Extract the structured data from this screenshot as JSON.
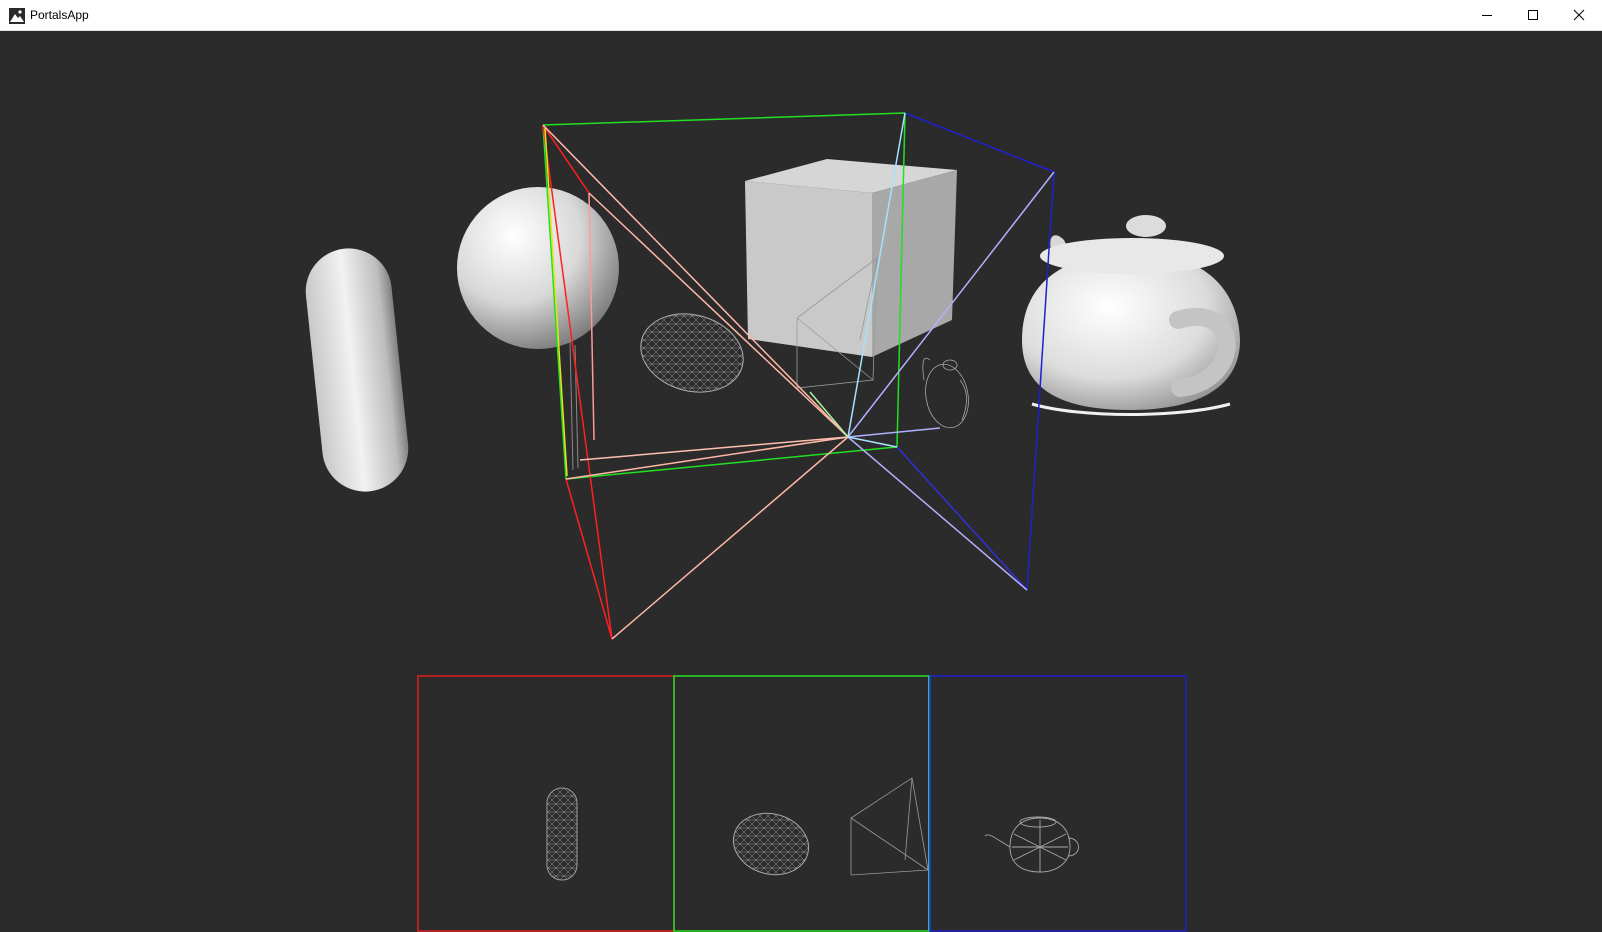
{
  "window": {
    "title": "PortalsApp",
    "app_icon": "portals-app-icon",
    "controls": {
      "minimize_icon": "minimize-icon",
      "maximize_icon": "maximize-icon",
      "close_icon": "close-icon"
    }
  },
  "scene": {
    "background_color": "#2b2b2b",
    "objects": [
      "capsule",
      "sphere",
      "cube",
      "teapot",
      "ellipsoid-wireframe",
      "pyramid-wireframe",
      "teapot-wireframe"
    ],
    "frustum_colors": {
      "red": "#ff2020",
      "green": "#20e020",
      "blue": "#2020ff",
      "pink": "#ffb0a0",
      "lavender": "#b0b0ff",
      "cyan": "#a0e0ff"
    }
  },
  "portals": [
    {
      "name": "red-portal",
      "border_color": "#e02020",
      "contents": "capsule-wireframe"
    },
    {
      "name": "green-portal",
      "border_color": "#20e020",
      "contents": "ellipsoid-and-pyramid-wireframe"
    },
    {
      "name": "blue-portal",
      "border_color": "#2020d0",
      "contents": "teapot-wireframe"
    }
  ]
}
